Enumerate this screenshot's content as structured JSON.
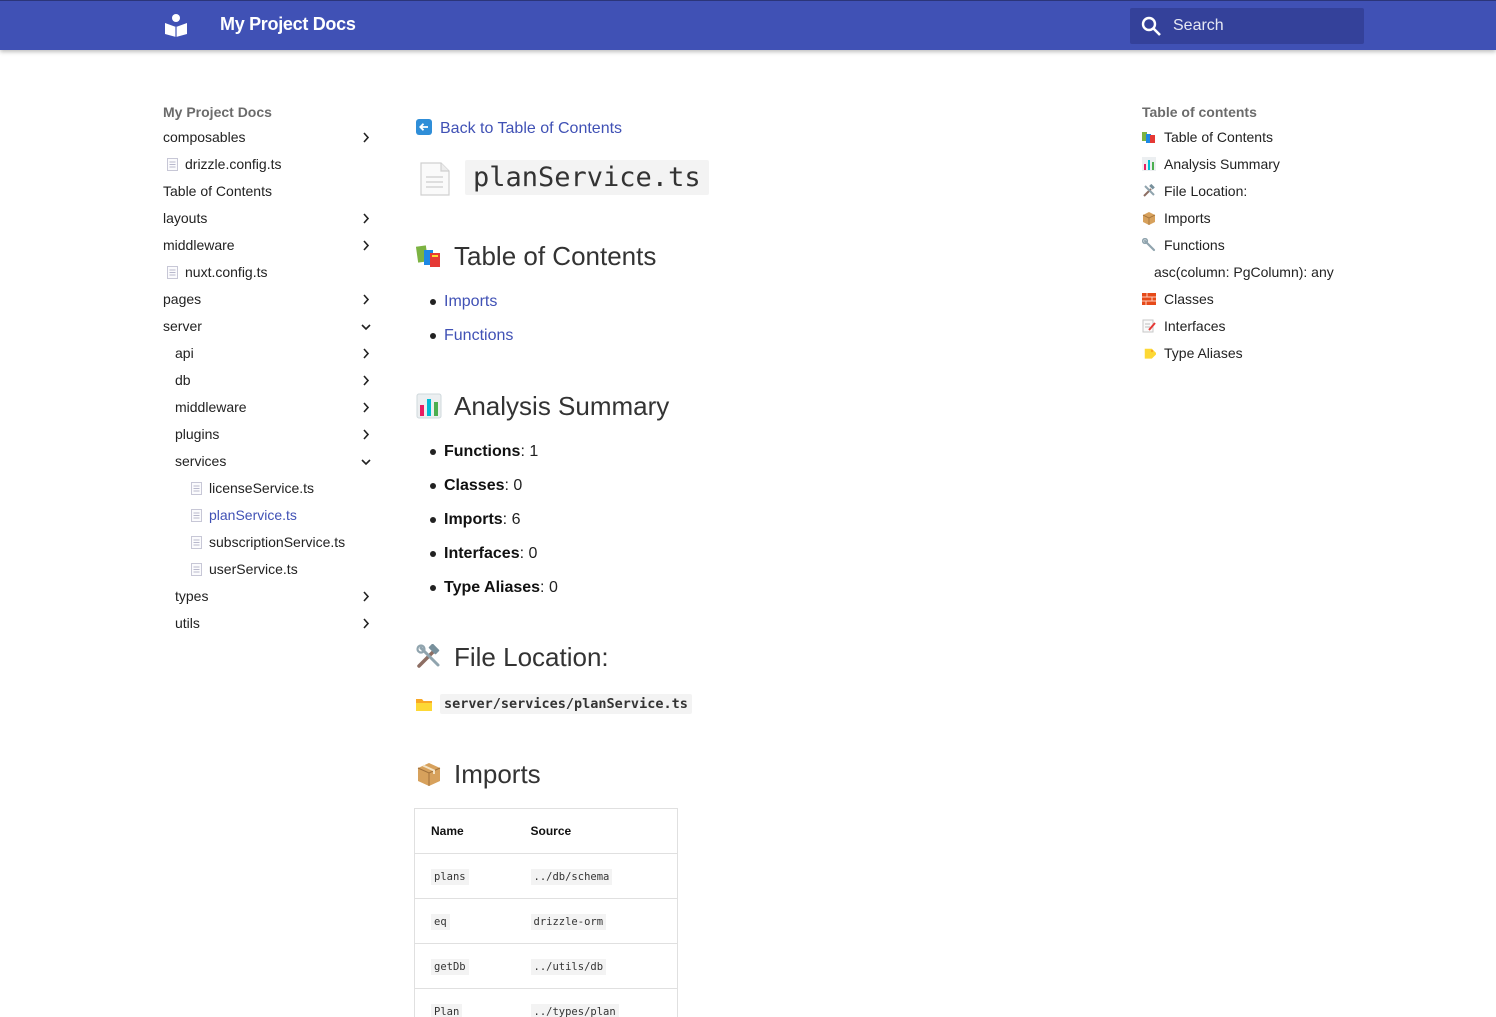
{
  "header": {
    "site_title": "My Project Docs",
    "search_placeholder": "Search"
  },
  "nav": {
    "title": "My Project Docs",
    "items": [
      {
        "label": "composables"
      },
      {
        "label": "drizzle.config.ts"
      },
      {
        "label": "Table of Contents"
      },
      {
        "label": "layouts"
      },
      {
        "label": "middleware"
      },
      {
        "label": "nuxt.config.ts"
      },
      {
        "label": "pages"
      },
      {
        "label": "server"
      },
      {
        "label": "api"
      },
      {
        "label": "db"
      },
      {
        "label": "middleware"
      },
      {
        "label": "plugins"
      },
      {
        "label": "services"
      },
      {
        "label": "licenseService.ts"
      },
      {
        "label": "planService.ts"
      },
      {
        "label": "subscriptionService.ts"
      },
      {
        "label": "userService.ts"
      },
      {
        "label": "types"
      },
      {
        "label": "utils"
      }
    ]
  },
  "content": {
    "back_link": "Back to Table of Contents",
    "page_title": "planService.ts",
    "toc_heading": "Table of Contents",
    "toc_links": [
      "Imports",
      "Functions"
    ],
    "summary_heading": "Analysis Summary",
    "summary": [
      {
        "label": "Functions",
        "value": ": 1"
      },
      {
        "label": "Classes",
        "value": ": 0"
      },
      {
        "label": "Imports",
        "value": ": 6"
      },
      {
        "label": "Interfaces",
        "value": ": 0"
      },
      {
        "label": "Type Aliases",
        "value": ": 0"
      }
    ],
    "location_heading": "File Location:",
    "location_path": "server/services/planService.ts",
    "imports_heading": "Imports",
    "imports_table": {
      "headers": [
        "Name",
        "Source"
      ],
      "rows": [
        [
          "plans",
          "../db/schema"
        ],
        [
          "eq",
          "drizzle-orm"
        ],
        [
          "getDb",
          "../utils/db"
        ],
        [
          "Plan",
          "../types/plan"
        ]
      ]
    }
  },
  "toc": {
    "title": "Table of contents",
    "items": [
      {
        "label": "Table of Contents"
      },
      {
        "label": "Analysis Summary"
      },
      {
        "label": "File Location:"
      },
      {
        "label": "Imports"
      },
      {
        "label": "Functions"
      },
      {
        "label": "asc(column: PgColumn): any"
      },
      {
        "label": "Classes"
      },
      {
        "label": "Interfaces"
      },
      {
        "label": "Type Aliases"
      }
    ]
  },
  "colors": {
    "header_bg": "#4051b5",
    "search_bg": "#34419a",
    "link": "#4051b5"
  }
}
